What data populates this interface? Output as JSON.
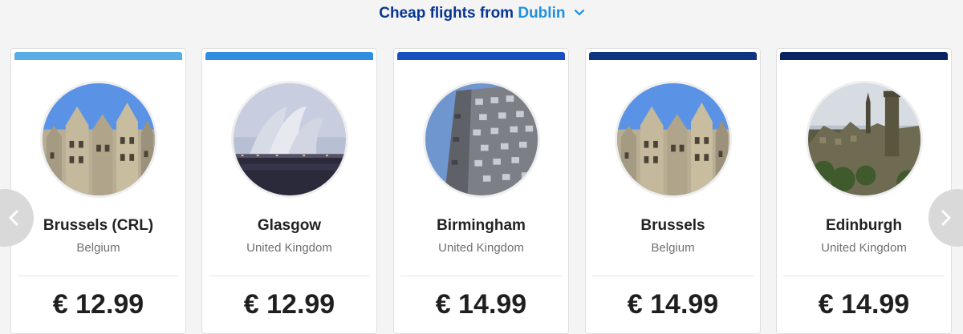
{
  "header": {
    "prefix": "Cheap flights from",
    "origin": "Dublin"
  },
  "carousel": {
    "cards": [
      {
        "city": "Brussels (CRL)",
        "country": "Belgium",
        "price": "€ 12.99",
        "bar_color": "#5aace6",
        "image": "brussels-grand-place"
      },
      {
        "city": "Glasgow",
        "country": "United Kingdom",
        "price": "€ 12.99",
        "bar_color": "#2f8ee0",
        "image": "glasgow-armadillo"
      },
      {
        "city": "Birmingham",
        "country": "United Kingdom",
        "price": "€ 14.99",
        "bar_color": "#1a4fbf",
        "image": "birmingham-cube"
      },
      {
        "city": "Brussels",
        "country": "Belgium",
        "price": "€ 14.99",
        "bar_color": "#0f3582",
        "image": "brussels-grand-place"
      },
      {
        "city": "Edinburgh",
        "country": "United Kingdom",
        "price": "€ 14.99",
        "bar_color": "#0a2463",
        "image": "edinburgh-skyline"
      }
    ]
  },
  "icons": {
    "header_dropdown": "chevron-down-icon",
    "prev": "chevron-left-icon",
    "next": "chevron-right-icon"
  }
}
